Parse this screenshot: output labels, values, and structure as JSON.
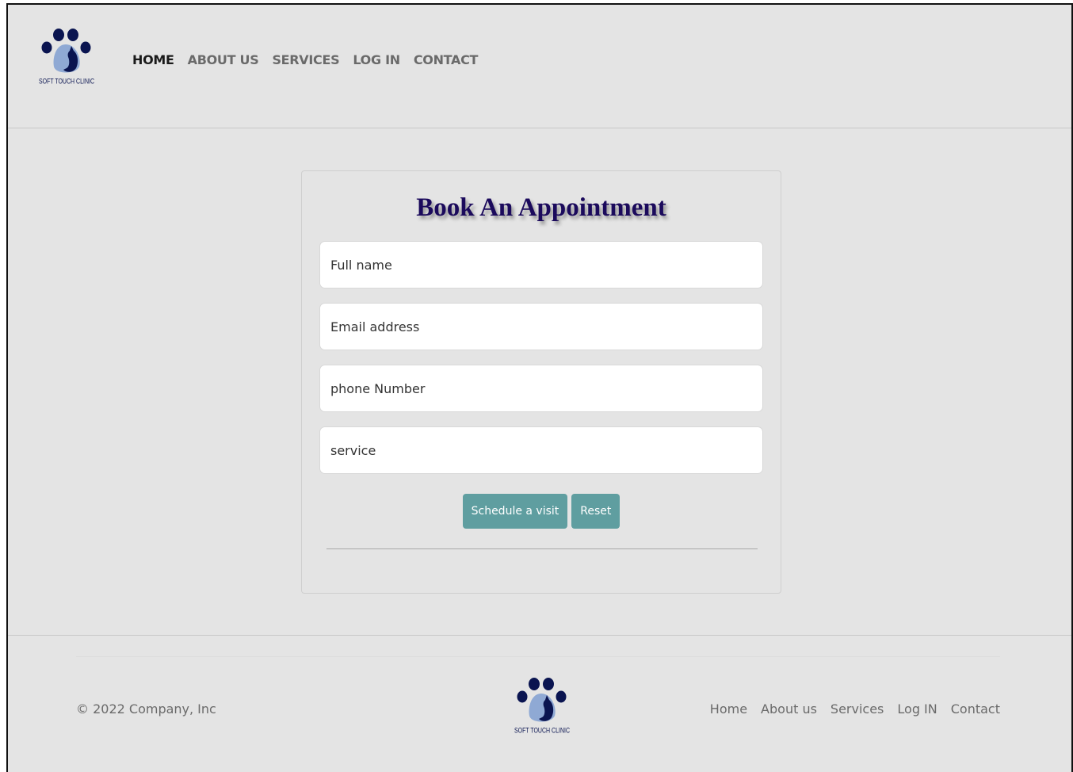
{
  "header": {
    "logo_text": "SOFT TOUCH CLINIC",
    "nav": [
      {
        "label": "HOME"
      },
      {
        "label": "ABOUT US"
      },
      {
        "label": "SERVICES"
      },
      {
        "label": "LOG IN"
      },
      {
        "label": "CONTACT"
      }
    ]
  },
  "form": {
    "title": "Book An Appointment",
    "fields": [
      {
        "placeholder": "Full name",
        "value": ""
      },
      {
        "placeholder": "Email address",
        "value": ""
      },
      {
        "placeholder": "phone Number",
        "value": ""
      },
      {
        "placeholder": "service",
        "value": ""
      }
    ],
    "submit_label": "Schedule a visit",
    "reset_label": "Reset"
  },
  "footer": {
    "copyright": "© 2022 Company, Inc",
    "logo_text": "SOFT TOUCH CLINIC",
    "links": [
      {
        "label": "Home"
      },
      {
        "label": "About us"
      },
      {
        "label": "Services"
      },
      {
        "label": "Log IN"
      },
      {
        "label": "Contact"
      }
    ]
  },
  "colors": {
    "page_bg": "#e4e4e4",
    "title": "#1b0a5c",
    "button": "#5f9ea0",
    "logo_dark": "#0a1450",
    "logo_light": "#8fa9d4"
  },
  "icons": [
    "paw-logo-icon"
  ]
}
